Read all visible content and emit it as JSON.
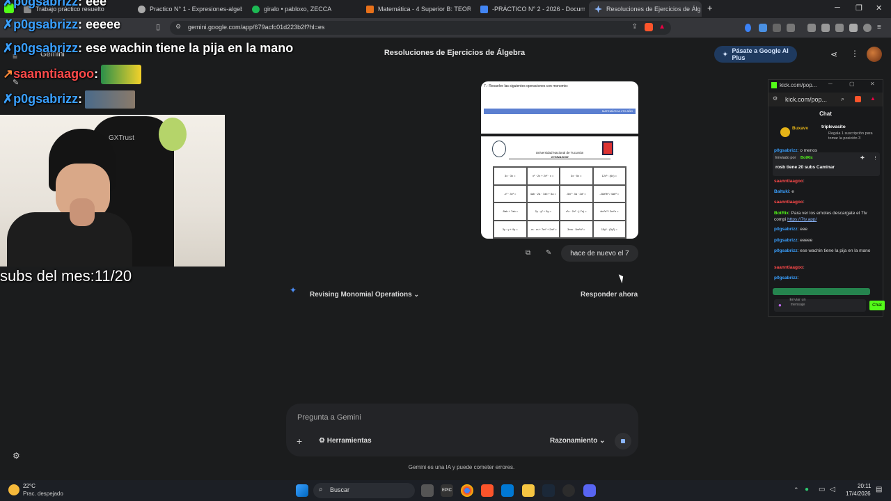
{
  "browser": {
    "tabs": [
      {
        "label": "Trabajo práctico resuelto"
      },
      {
        "label": "Practico N° 1 - Expresiones-algebraic"
      },
      {
        "label": "giralo • pabloxo, ZECCA"
      },
      {
        "label": "Matemática - 4 Superior B: TEORÍA -"
      },
      {
        "label": "-PRÁCTICO N° 2 - 2026 - Documento"
      },
      {
        "label": "Resoluciones de Ejercicios de Álg"
      }
    ],
    "new_tab": "+",
    "url": "gemini.google.com/app/679acfc01d223b2f?hl=es"
  },
  "gemini": {
    "app_name": "Gemini",
    "title": "Resoluciones de Ejercicios de Álgebra",
    "upgrade_label": "Pásate a Google AI Plus",
    "user_message": "hace de nuevo el 7",
    "reasoning_label": "Revising Monomial Operations",
    "respond_now": "Responder ahora",
    "prompt_placeholder": "Pregunta a Gemini",
    "tools_label": "Herramientas",
    "mode_label": "Razonamiento",
    "disclaimer": "Gemini es una IA y puede cometer errores.",
    "attachment": {
      "header": "7.- Resuelve las siguientes operaciones con monomio:",
      "band": "MATEMÁTICA 4TO AÑO",
      "university": "Universidad Nacional de Tucumán",
      "school": "GYMNASIUM",
      "cells": [
        "3x · 3x =",
        "x² · 2x + 2x² · x =",
        "3x · 5x =",
        "12x³ : (6x) =",
        "-x² · 3x² =",
        "4ab · 2a · 7ab + 5a =",
        "-5a² · 3a · 2a² =",
        "-28a³b² / 4ab³ =",
        "-5ab + 7ab =",
        "2y · y² + 5y =",
        "x²z · 2z² · (-7z) =",
        "4m²n³ / 2m²n =",
        "3y · y + 9y =",
        "- m · m + 7m² + 2m² =",
        "3mn · 5m²n² =",
        "15y⁵ : (5y³) ="
      ]
    }
  },
  "stream_overlay": {
    "lines": [
      {
        "user": "p0gsabrizz",
        "text": ": eee"
      },
      {
        "user": "p0gsabrizz",
        "text": ": eeeee"
      },
      {
        "user": "p0gsabrizz",
        "text": ": ese wachin tiene la pija en la mano"
      },
      {
        "user": "saanntiaagoo",
        "text": ":"
      },
      {
        "user": "p0gsabrizz",
        "text": ":"
      }
    ],
    "subs_counter": "subs del mes:11/20",
    "webcam_text": "GXTrust"
  },
  "kick_chat": {
    "window_title": "kick.com/pop...",
    "url": "kick.com/pop...",
    "header": "Chat",
    "top_user_1": "Buxavv",
    "top_user_2": "triplevasito",
    "gift_text": "Regala 1 suscripción para tomar la posición 3",
    "pinned_by": "Enviado por",
    "pinned_bot": "BotRix",
    "pinned_text": "rosb tiene 20 subs Caminar",
    "messages": [
      {
        "user": "p0gsabrizz",
        "text": ": o menos"
      },
      {
        "user": "saanntiaagoo",
        "text": ":"
      },
      {
        "user": "Baltuki",
        "text": ": e"
      },
      {
        "user": "saanntiaagoo",
        "text": ":"
      },
      {
        "user": "BotRix",
        "text": ": Para ver los emotes descargate el 7tv compi"
      },
      {
        "user": "",
        "text": "https://7tv.app/"
      },
      {
        "user": "p0gsabrizz",
        "text": ": eee"
      },
      {
        "user": "p0gsabrizz",
        "text": ": eeeee"
      },
      {
        "user": "p0gsabrizz",
        "text": ": ese wachin tiene la pija en la mano"
      },
      {
        "user": "saanntiaagoo",
        "text": ":"
      },
      {
        "user": "p0gsabrizz",
        "text": ":"
      }
    ],
    "input_placeholder": "Enviar un mensaje",
    "chat_button": "Chat"
  },
  "taskbar": {
    "weather_temp": "22°C",
    "weather_desc": "Prac. despejado",
    "search_label": "Buscar",
    "time": "20:11",
    "date": "17/4/2026",
    "epic_label": "EPIC"
  },
  "colors": {
    "gemini_bg": "#1b1c1d",
    "accent_blue": "#1f3a5f",
    "kick_green": "#53fc18",
    "overlay_blue": "#3aa0ff",
    "overlay_red": "#ff4a4a"
  }
}
